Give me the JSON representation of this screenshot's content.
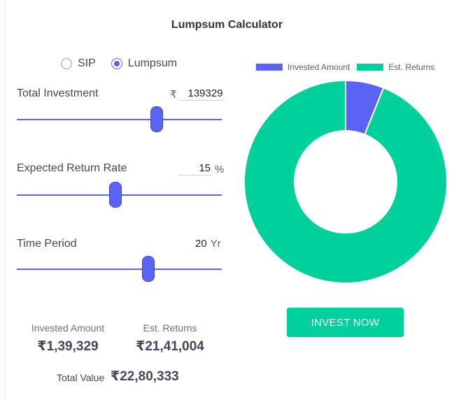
{
  "title": "Lumpsum Calculator",
  "mode": {
    "options": [
      {
        "label": "SIP",
        "selected": false
      },
      {
        "label": "Lumpsum",
        "selected": true
      }
    ]
  },
  "fields": {
    "investment": {
      "label": "Total Investment",
      "prefix": "₹",
      "value": "139329",
      "slider_fraction": 0.68
    },
    "rate": {
      "label": "Expected Return Rate",
      "value": "15",
      "suffix": "%",
      "slider_fraction": 0.48
    },
    "period": {
      "label": "Time Period",
      "value": "20",
      "suffix": "Yr",
      "slider_fraction": 0.64
    }
  },
  "legend": {
    "invested": {
      "label": "Invested Amount",
      "color": "#5b63f5"
    },
    "returns": {
      "label": "Est. Returns",
      "color": "#00d09c"
    }
  },
  "chart_data": {
    "type": "pie",
    "categories": [
      "Invested Amount",
      "Est. Returns"
    ],
    "values": [
      139329,
      2141004
    ],
    "colors": [
      "#5b63f5",
      "#00d09c"
    ]
  },
  "button": {
    "label": "INVEST NOW"
  },
  "summary": {
    "invested_label": "Invested Amount",
    "invested_value": "₹1,39,329",
    "returns_label": "Est. Returns",
    "returns_value": "₹21,41,004",
    "total_label": "Total Value",
    "total_value": "₹22,80,333"
  }
}
